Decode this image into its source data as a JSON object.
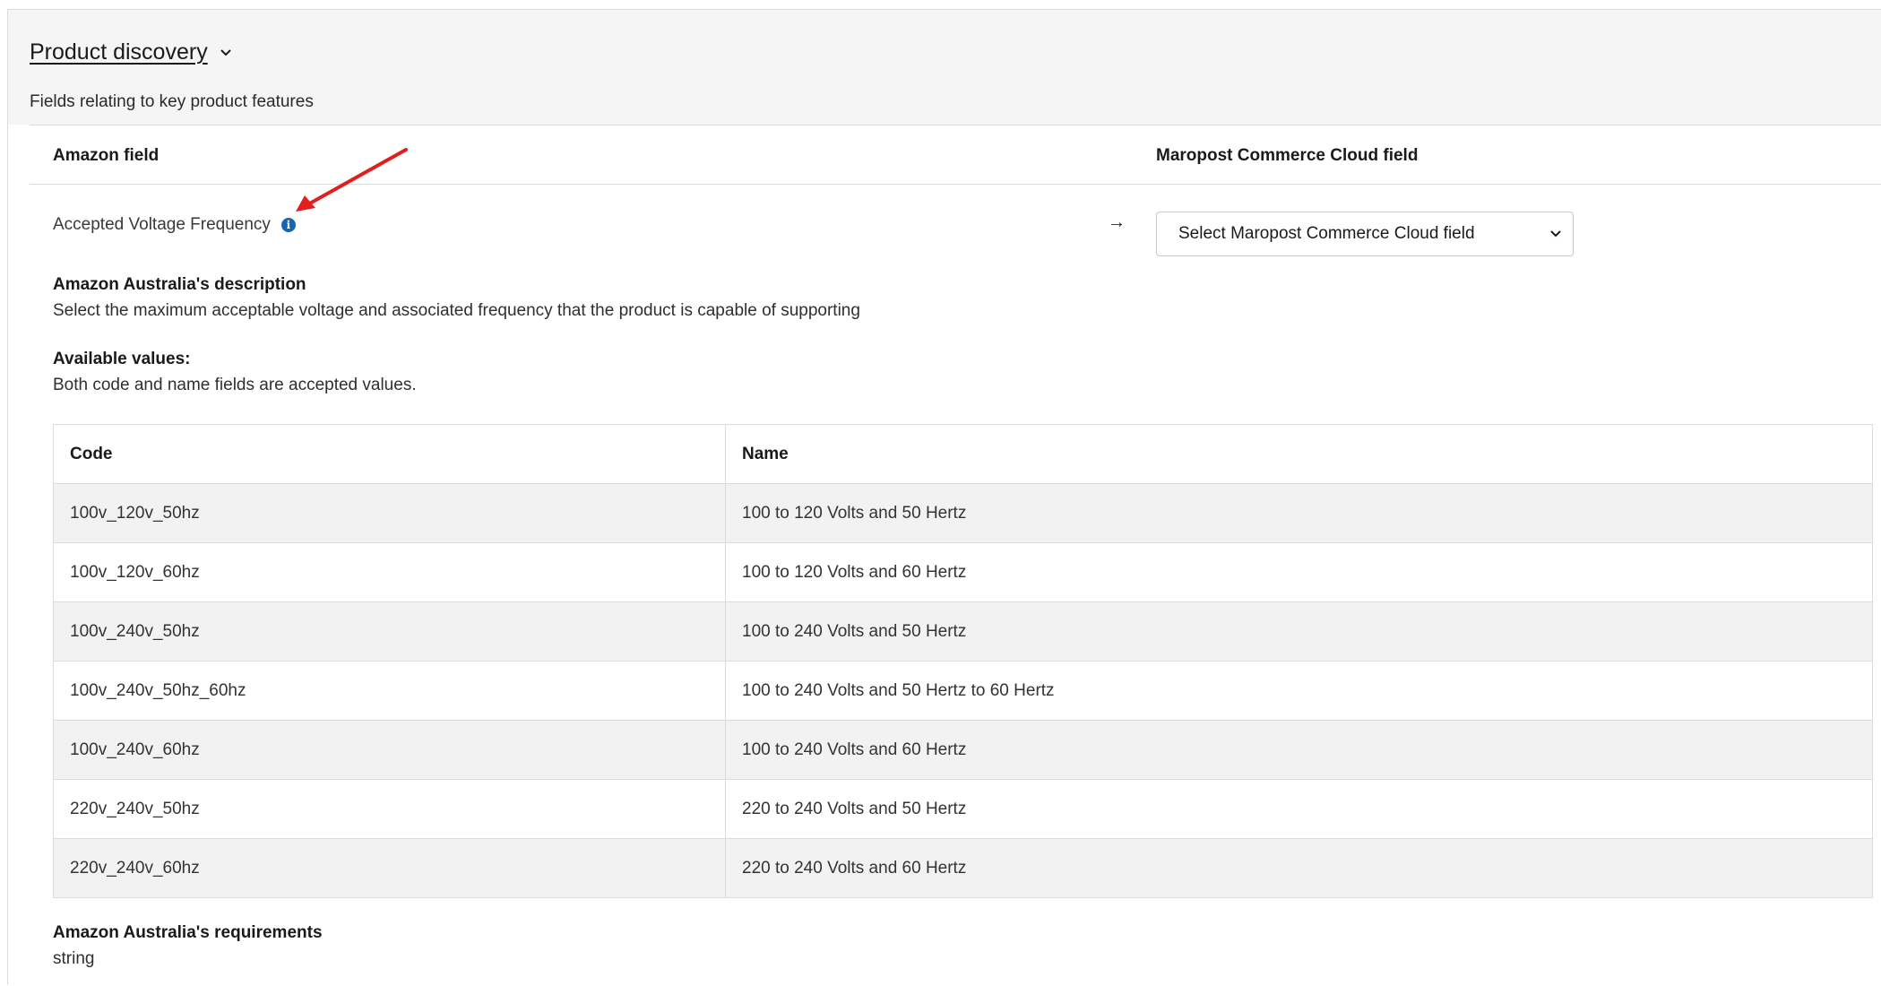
{
  "section": {
    "title": "Product discovery",
    "subtitle": "Fields relating to key product features"
  },
  "mapping": {
    "col_amazon": "Amazon field",
    "col_maropost": "Maropost Commerce Cloud field",
    "field_label": "Accepted Voltage Frequency",
    "arrow": "→",
    "select_value": "Select Maropost Commerce Cloud field"
  },
  "description": {
    "title": "Amazon Australia's description",
    "text": "Select the maximum acceptable voltage and associated frequency that the product is capable of supporting"
  },
  "available": {
    "title": "Available values:",
    "text": "Both code and name fields are accepted values."
  },
  "values_table": {
    "headers": [
      "Code",
      "Name"
    ],
    "rows": [
      {
        "code": "100v_120v_50hz",
        "name": "100 to 120 Volts and 50 Hertz"
      },
      {
        "code": "100v_120v_60hz",
        "name": "100 to 120 Volts and 60 Hertz"
      },
      {
        "code": "100v_240v_50hz",
        "name": "100 to 240 Volts and 50 Hertz"
      },
      {
        "code": "100v_240v_50hz_60hz",
        "name": "100 to 240 Volts and 50 Hertz to 60 Hertz"
      },
      {
        "code": "100v_240v_60hz",
        "name": "100 to 240 Volts and 60 Hertz"
      },
      {
        "code": "220v_240v_50hz",
        "name": "220 to 240 Volts and 50 Hertz"
      },
      {
        "code": "220v_240v_60hz",
        "name": "220 to 240 Volts and 60 Hertz"
      }
    ]
  },
  "requirements": {
    "title": "Amazon Australia's requirements",
    "text": "string"
  },
  "colors": {
    "info_icon": "#1565b4",
    "annotation_arrow": "#e02020",
    "row_stripe": "#f2f2f2",
    "header_bg": "#f5f5f5"
  },
  "icons": {
    "section_toggle": "chevron-down-icon",
    "field_info": "info-icon",
    "mapping_arrow": "arrow-right-icon",
    "select_caret": "chevron-down-icon",
    "annotation": "red-arrow-annotation"
  }
}
